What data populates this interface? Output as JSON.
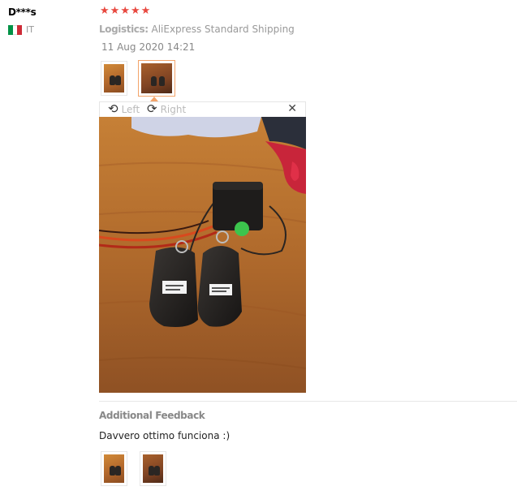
{
  "reviewer": {
    "name": "D***s",
    "country_code": "IT",
    "flag_colors": [
      "#009246",
      "#ffffff",
      "#ce2b37"
    ]
  },
  "rating": {
    "stars": 5,
    "max": 5,
    "star_glyph": "★",
    "color": "#e8483f"
  },
  "logistics": {
    "label": "Logistics:",
    "value": "AliExpress Standard Shipping"
  },
  "date": "11 Aug 2020 14:21",
  "viewer": {
    "rotate_left_label": "Left",
    "rotate_right_label": "Right"
  },
  "additional": {
    "title": "Additional Feedback",
    "text": "Davvero ottimo funciona :)"
  },
  "accent": "#f3a46a"
}
